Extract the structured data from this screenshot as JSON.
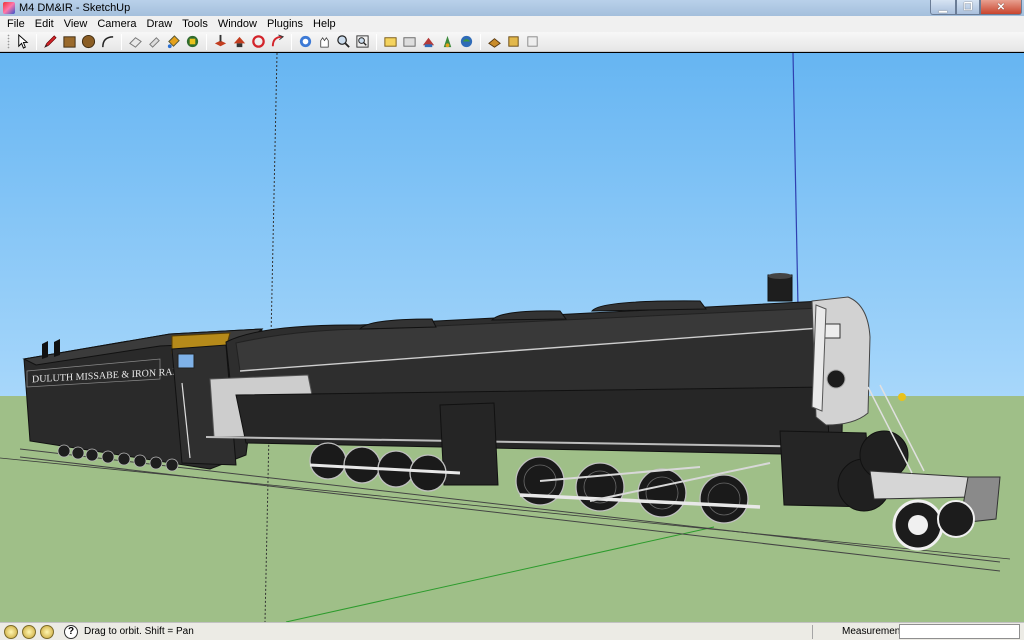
{
  "window": {
    "title": "M4 DM&IR - SketchUp",
    "buttons": {
      "minimize": "▁",
      "maximize": "❐",
      "close": "✕"
    }
  },
  "menu": [
    "File",
    "Edit",
    "View",
    "Camera",
    "Draw",
    "Tools",
    "Window",
    "Plugins",
    "Help"
  ],
  "toolbar": {
    "groups": [
      [
        "select-icon"
      ],
      [
        "pencil-icon",
        "rectangle-icon",
        "circle-icon",
        "arc-icon"
      ],
      [
        "eraser-icon",
        "tape-measure-icon",
        "paint-bucket-icon",
        "move-icon"
      ],
      [
        "push-pull-icon",
        "rotate-icon",
        "follow-me-icon",
        "offset-icon"
      ],
      [
        "orbit-icon",
        "pan-icon",
        "zoom-icon",
        "zoom-extents-icon"
      ],
      [
        "3d-warehouse-icon",
        "share-model-icon",
        "get-models-icon",
        "components-icon",
        "styles-icon"
      ],
      [
        "sandbox-icon",
        "photo-match-icon",
        "geo-location-icon"
      ]
    ]
  },
  "model": {
    "tender_lettering": "DULUTH MISSABE & IRON RANGE",
    "colors": {
      "sky_top": "#66b5f2",
      "sky_bottom": "#c7e6fb",
      "ground": "#9fbf88",
      "locomotive": "#2e2e2e",
      "smokebox_light": "#c9c9c9",
      "cab_roof": "#b58a1a"
    }
  },
  "status": {
    "hint": "Drag to orbit.  Shift = Pan",
    "measurements_label": "Measurements",
    "measurements_value": ""
  }
}
